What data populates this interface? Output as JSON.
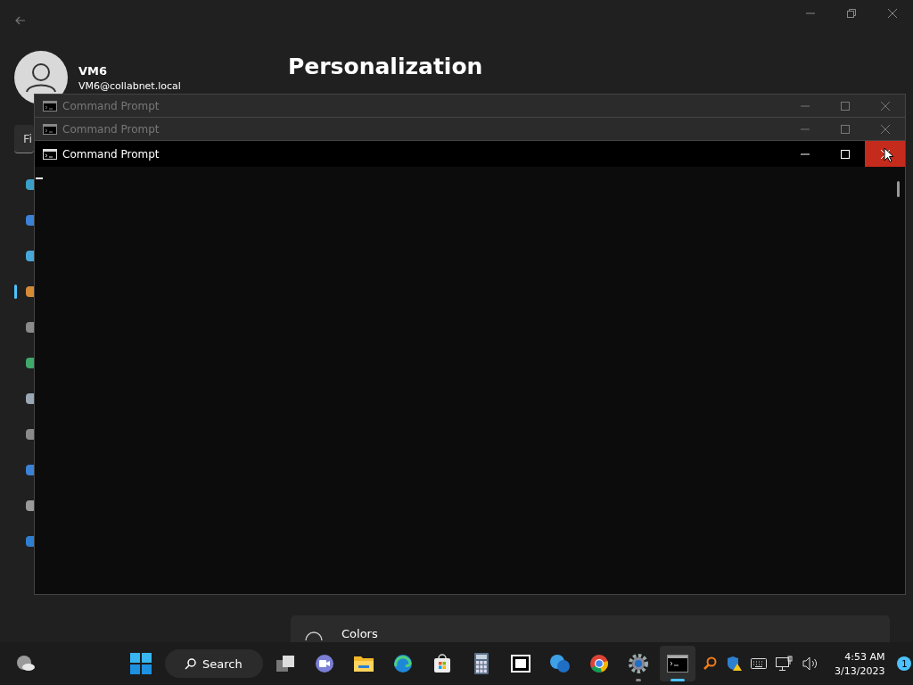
{
  "settings": {
    "user": {
      "name": "VM6",
      "email": "VM6@collabnet.local"
    },
    "page_title": "Personalization",
    "search": {
      "value": "Fi"
    },
    "sidebar": [
      {
        "kind": "system",
        "selected": false
      },
      {
        "kind": "bluetooth",
        "selected": false
      },
      {
        "kind": "network",
        "selected": false
      },
      {
        "kind": "personalization",
        "selected": true
      },
      {
        "kind": "apps",
        "selected": false
      },
      {
        "kind": "accounts",
        "selected": false
      },
      {
        "kind": "time",
        "selected": false
      },
      {
        "kind": "gaming",
        "selected": false
      },
      {
        "kind": "accessibility",
        "selected": false
      },
      {
        "kind": "privacy",
        "selected": false
      },
      {
        "kind": "update",
        "selected": false
      }
    ],
    "cards": [
      {
        "label": "Colors"
      }
    ]
  },
  "cmd_windows": [
    {
      "title": "Command Prompt",
      "active": false,
      "close_hovered": false
    },
    {
      "title": "Command Prompt",
      "active": false,
      "close_hovered": false
    },
    {
      "title": "Command Prompt",
      "active": true,
      "close_hovered": true
    }
  ],
  "taskbar": {
    "search_label": "Search",
    "apps": [
      {
        "kind": "taskview",
        "running": false,
        "active": false
      },
      {
        "kind": "teams",
        "running": false,
        "active": false
      },
      {
        "kind": "explorer",
        "running": false,
        "active": false
      },
      {
        "kind": "edge",
        "running": false,
        "active": false
      },
      {
        "kind": "store",
        "running": false,
        "active": false
      },
      {
        "kind": "calculator",
        "running": false,
        "active": false
      },
      {
        "kind": "sevenzip",
        "running": false,
        "active": false
      },
      {
        "kind": "help",
        "running": false,
        "active": false
      },
      {
        "kind": "chrome",
        "running": false,
        "active": false
      },
      {
        "kind": "settings",
        "running": true,
        "active": false
      },
      {
        "kind": "cmd",
        "running": true,
        "active": true
      }
    ],
    "time": "4:53 AM",
    "date": "3/13/2023",
    "notifications": "1"
  }
}
